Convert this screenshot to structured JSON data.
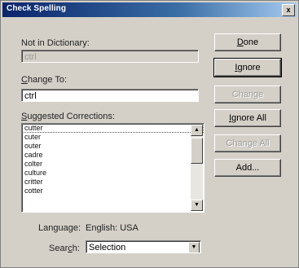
{
  "window": {
    "title": "Check Spelling",
    "close_glyph": "x"
  },
  "not_in_dictionary": {
    "label_pre": "Not in Dictionary:",
    "value": "ctrl"
  },
  "change_to": {
    "label_access": "C",
    "label_rest": "hange To:",
    "value": "ctrl"
  },
  "suggested": {
    "label_access": "S",
    "label_rest": "uggested Corrections:",
    "items": [
      "cutter",
      "cuter",
      "outer",
      "cadre",
      "colter",
      "culture",
      "critter",
      "cotter"
    ]
  },
  "buttons": {
    "done_access": "D",
    "done_rest": "one",
    "ignore_access": "I",
    "ignore_rest": "gnore",
    "change": "Change",
    "ignore_all_access": "I",
    "ignore_all_rest": "gnore All",
    "change_all": "Change All",
    "add": "Add..."
  },
  "language": {
    "label": "Language:",
    "value": "English: USA"
  },
  "search": {
    "label_pre": "Sear",
    "label_access": "c",
    "label_post": "h:",
    "value": "Selection"
  },
  "icons": {
    "scroll_up": "up-arrow-icon",
    "scroll_down": "down-arrow-icon",
    "dropdown": "chevron-down-icon"
  }
}
